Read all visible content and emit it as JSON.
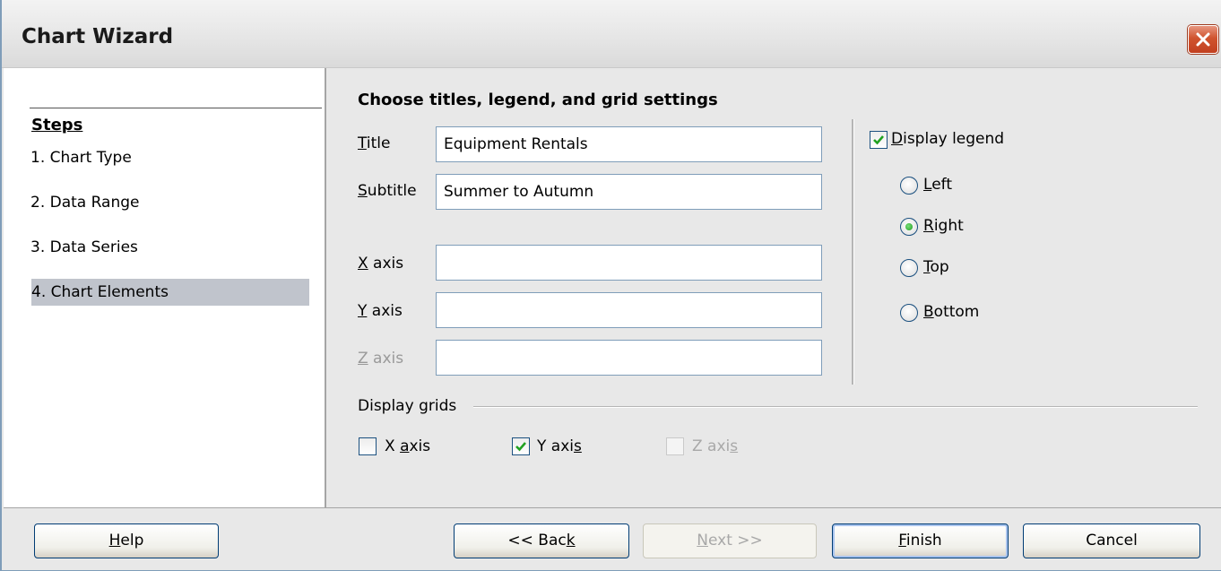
{
  "window": {
    "title": "Chart Wizard",
    "close_icon": "close-icon"
  },
  "steps": {
    "heading": "Steps",
    "items": [
      {
        "label": "1. Chart Type",
        "selected": false
      },
      {
        "label": "2. Data Range",
        "selected": false
      },
      {
        "label": "3. Data Series",
        "selected": false
      },
      {
        "label": "4. Chart Elements",
        "selected": true
      }
    ]
  },
  "main": {
    "section_title": "Choose titles, legend, and grid settings",
    "fields": {
      "title": {
        "mnemonic": "T",
        "rest": "itle",
        "value": "Equipment Rentals"
      },
      "subtitle": {
        "mnemonic": "S",
        "rest": "ubtitle",
        "value": "Summer to Autumn"
      },
      "x_axis": {
        "mnemonic": "X",
        "rest": " axis",
        "value": ""
      },
      "y_axis": {
        "mnemonic": "Y",
        "rest": " axis",
        "value": ""
      },
      "z_axis": {
        "mnemonic": "Z",
        "rest": " axis",
        "value": "",
        "disabled": true
      }
    },
    "legend": {
      "display_mnemonic": "D",
      "display_rest": "isplay legend",
      "display_checked": true,
      "options": [
        {
          "mnemonic": "L",
          "rest": "eft",
          "checked": false
        },
        {
          "mnemonic": "R",
          "rest": "ight",
          "checked": true
        },
        {
          "mnemonic": "T",
          "rest": "op",
          "checked": false
        },
        {
          "mnemonic": "B",
          "rest": "ottom",
          "checked": false
        }
      ]
    },
    "grids": {
      "label": "Display grids",
      "x": {
        "pre": "X ",
        "mnemonic": "a",
        "rest": "xis",
        "checked": false
      },
      "y": {
        "pre": "Y axi",
        "mnemonic": "s",
        "rest": "",
        "checked": true
      },
      "z": {
        "pre": "Z axi",
        "mnemonic": "s",
        "rest": "",
        "checked": false,
        "disabled": true
      }
    }
  },
  "footer": {
    "help": {
      "mnemonic": "H",
      "rest": "elp"
    },
    "back": {
      "pre": "<< Bac",
      "mnemonic": "k"
    },
    "next": {
      "mnemonic": "N",
      "rest": "ext >>",
      "disabled": true
    },
    "finish": {
      "mnemonic": "F",
      "rest": "inish"
    },
    "cancel": "Cancel"
  },
  "colors": {
    "selected_step_bg": "#c0c4cc",
    "check_green": "#21a121",
    "close_red": "#d0542f"
  }
}
